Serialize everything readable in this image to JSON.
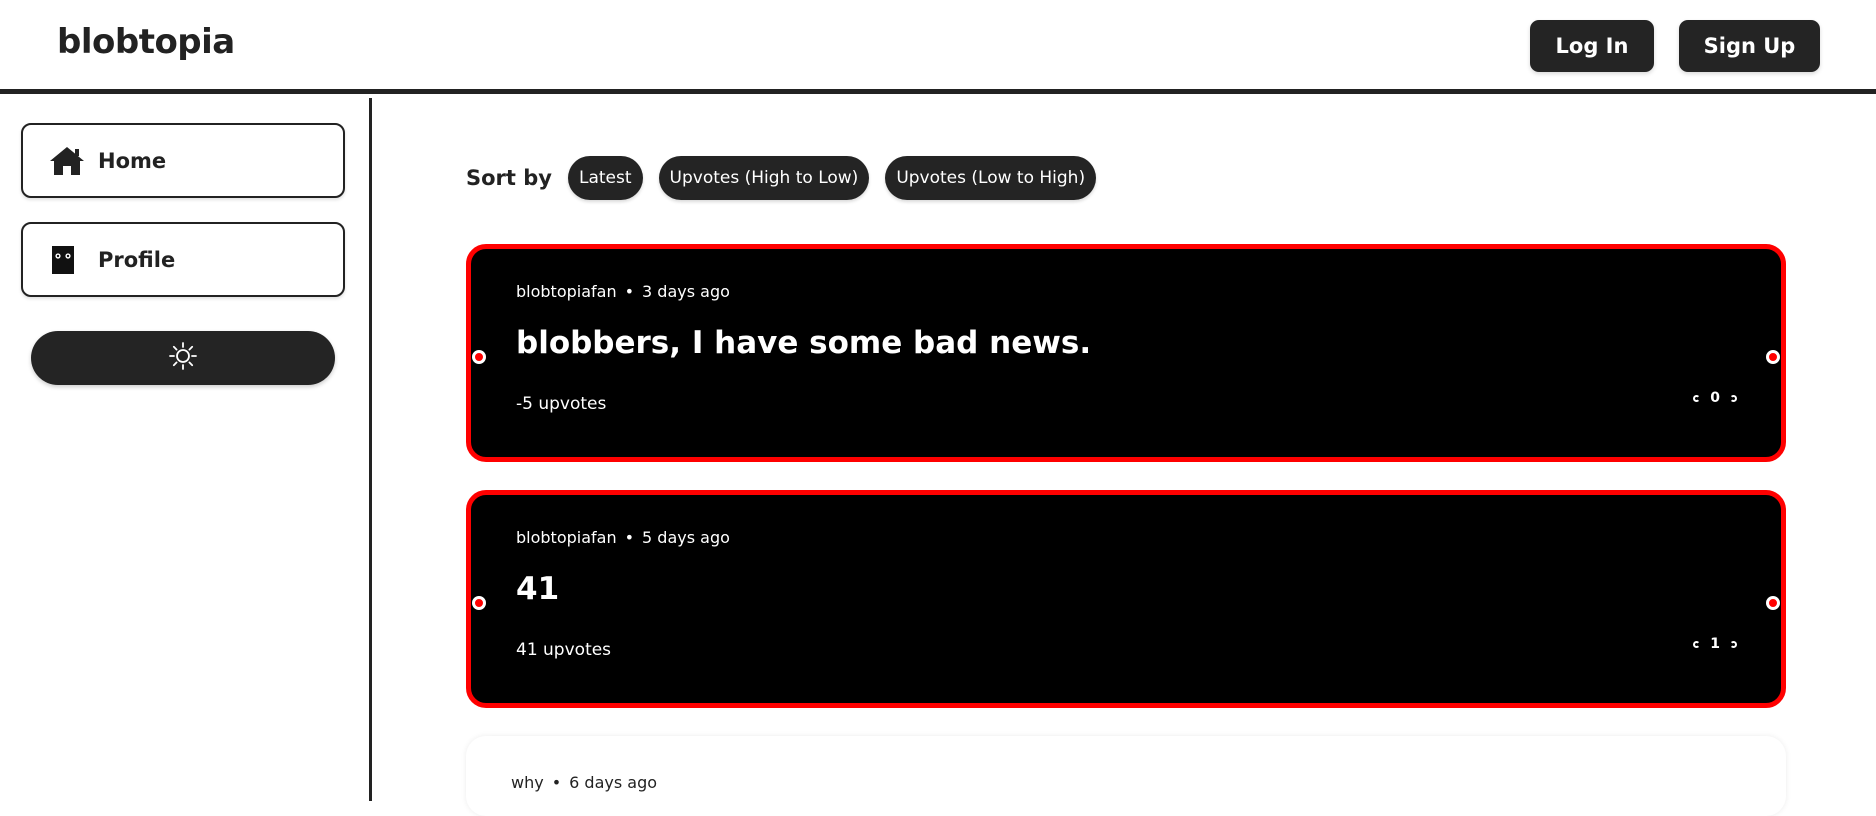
{
  "header": {
    "logo": "blobtopia",
    "login_label": "Log In",
    "signup_label": "Sign Up"
  },
  "sidebar": {
    "items": [
      {
        "label": "Home",
        "icon": "home-icon"
      },
      {
        "label": "Profile",
        "icon": "profile-icon"
      }
    ],
    "theme_toggle_icon": "sun-icon"
  },
  "sort": {
    "label": "Sort by",
    "options": [
      "Latest",
      "Upvotes (High to Low)",
      "Upvotes (Low to High)"
    ]
  },
  "posts": [
    {
      "author": "blobtopiafan",
      "time": "3 days ago",
      "title": "blobbers, I have some bad news.",
      "upvotes": "-5 upvotes",
      "vote_count": "0"
    },
    {
      "author": "blobtopiafan",
      "time": "5 days ago",
      "title": "41",
      "upvotes": "41 upvotes",
      "vote_count": "1"
    },
    {
      "author": "why",
      "time": "6 days ago"
    }
  ],
  "colors": {
    "accent": "#ff0000",
    "dark": "#242424"
  }
}
